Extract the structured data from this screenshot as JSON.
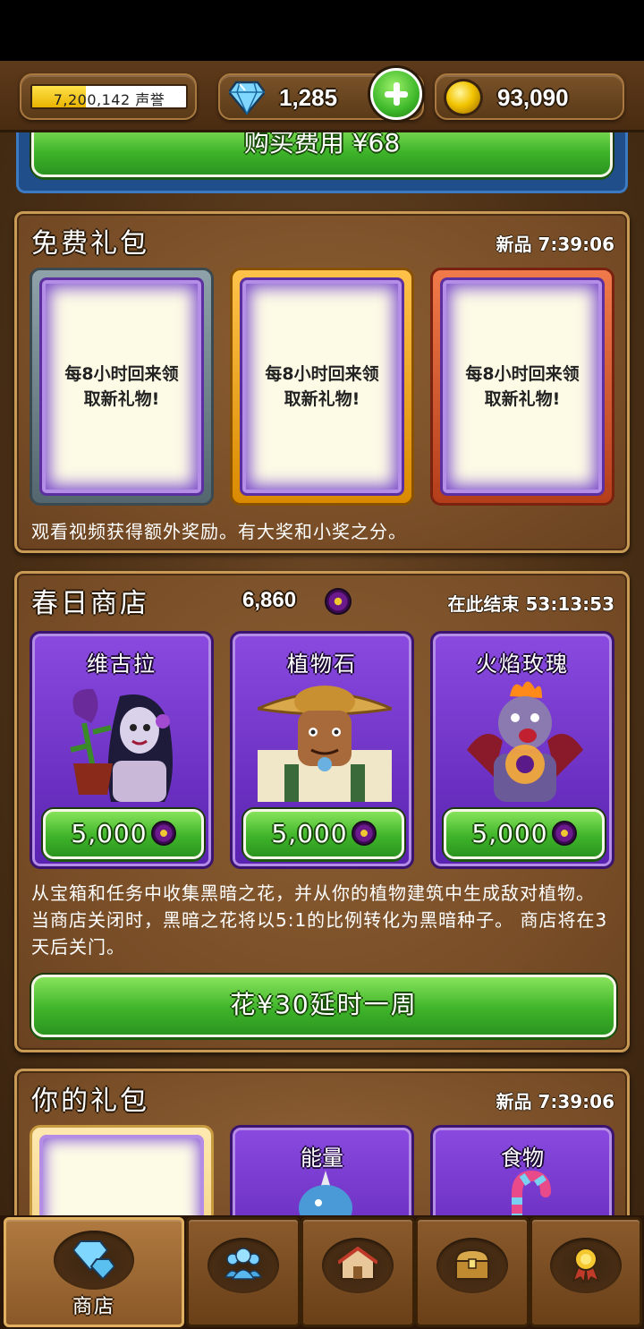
{
  "currency": {
    "reputation_text": "7,200,142 声誉",
    "reputation_progress": 0.35,
    "gems": "1,285",
    "gold": "93,090"
  },
  "buy_button": {
    "label": "购买费用 ¥68"
  },
  "free_gift": {
    "title": "免费礼包",
    "timer": "新品 7:39:06",
    "cards": [
      {
        "text": "每8小时回来领取新礼物!",
        "frame": "silver"
      },
      {
        "text": "每8小时回来领取新礼物!",
        "frame": "gold"
      },
      {
        "text": "每8小时回来领取新礼物!",
        "frame": "red"
      }
    ],
    "description": "观看视频获得额外奖励。有大奖和小奖之分。"
  },
  "spring_shop": {
    "title": "春日商店",
    "flower_count": "6,860",
    "timer": "在此结束 53:13:53",
    "items": [
      {
        "name": "维古拉",
        "price": "5,000",
        "icon": "vampire-girl-plant-icon"
      },
      {
        "name": "植物石",
        "price": "5,000",
        "icon": "farmer-icon"
      },
      {
        "name": "火焰玫瑰",
        "price": "5,000",
        "icon": "fire-demon-icon"
      }
    ],
    "description": "从宝箱和任务中收集黑暗之花，并从你的植物建筑中生成敌对植物。当商店关闭时，黑暗之花将以5:1的比例转化为黑暗种子。 商店将在3 天后关门。",
    "extend_label": "花¥30延时一周"
  },
  "your_gifts": {
    "title": "你的礼包",
    "timer": "新品 7:39:06",
    "cards": [
      {
        "name": ""
      },
      {
        "name": "能量",
        "icon": "unicorn-icon"
      },
      {
        "name": "食物",
        "icon": "candy-cane-icon"
      }
    ]
  },
  "nav": {
    "shop_label": "商店",
    "tabs": [
      "diamond-icon",
      "people-icon",
      "buildings-icon",
      "chest-icon",
      "medal-icon"
    ]
  },
  "colors": {
    "accent_green": "#3fb42a",
    "panel_brown": "#7a4f28",
    "card_purple": "#5a22b0"
  }
}
